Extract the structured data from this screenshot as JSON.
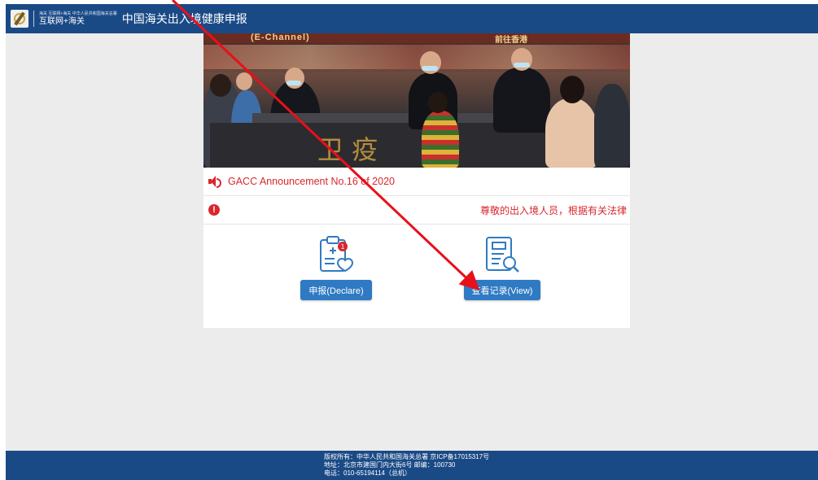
{
  "header": {
    "logo_small_text": "海关 互联网+海关 中华人民共和国海关总署",
    "logo_sub_text": "互联网+海关",
    "title": "中国海关出入境健康申报"
  },
  "banner": {
    "sign_left": "(E-Channel)",
    "sign_right": "前往香港",
    "emblem_text": "卫 疫"
  },
  "announcement": {
    "text": "GACC Announcement No.16 of 2020",
    "scrolling_text": "尊敬的出入境人员，根据有关法律"
  },
  "actions": {
    "declare_label": "申报(Declare)",
    "view_label": "查看记录(View)"
  },
  "footer": {
    "line1": "版权所有：中华人民共和国海关总署 京ICP备17015317号",
    "line2": "地址：北京市建国门内大街6号 邮编：100730",
    "line3": "电话：010-65194114（总机）"
  },
  "colors": {
    "brand_blue": "#1a4a86",
    "button_blue": "#2f7ac3",
    "alert_red": "#d9262c",
    "annotation_red": "#e8101a"
  },
  "icons": [
    "speaker-icon",
    "alert-icon",
    "health-declare-icon",
    "view-record-icon"
  ]
}
